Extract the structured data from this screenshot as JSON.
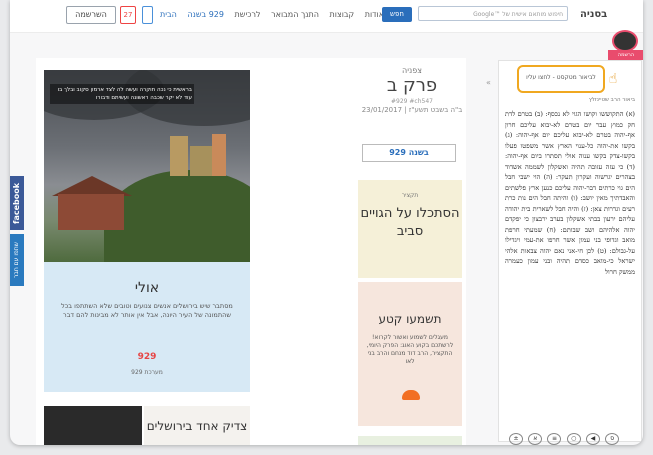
{
  "header": {
    "login_label": "השרשמה",
    "calendar_day": "27",
    "nav_items": [
      "אודות",
      "קבוצות",
      "התנך המבואר",
      "לרכישת"
    ],
    "counter_label": "929 בשנה",
    "home_label": "הבית",
    "search_button": "חפש",
    "search_placeholder": "Google™ חיפוש מותאם אישית של",
    "app_name": "בסניה"
  },
  "subheader": {
    "label": "ב"
  },
  "side": {
    "facebook": "facebook",
    "share": "שתפו עם חבר"
  },
  "feature": {
    "overlay_text": "בראשית כי נכה חוקרה ועשה לה לצד ארמון סקוב ובלך בו עוד לא יקר שכבה ראשונה ועשיתם ודבורו",
    "title": "אולי",
    "description": "מסתבר שיש בירושלים אנשים צנועים וטובים שלא השתתפו בכל שהתמונה של העיר היונה, אבל אין אותר לא מבינות להם דבר",
    "brand": "929",
    "brand_caption": "מערכת 929"
  },
  "bottom_card": {
    "title": "צדיק אחד בירושלים"
  },
  "chapter": {
    "book": "צפניה",
    "title": "פרק ב",
    "meta": "#929 #ch547",
    "date": "23/01/2017 | ב\"ה בשבט תשע\"ז",
    "counter_button": "929 בשנה"
  },
  "card_yellow": {
    "kicker": "תקציר",
    "title": "הסתכלו על הגויים סביב"
  },
  "card_pink": {
    "title": "תשמעו קטע",
    "description": "מעגלים לשמוע ואשור לקרוא! לרשתכם בקוע האוג: הפרק היומי, התקציר, הרב דוד מנחם והרב בני לאו"
  },
  "panel": {
    "header": "לביאור מטקסט - לחצו עליו",
    "subheading": "ביאור הרב שטיינזלץ",
    "text": "(א) התקוששו וקושו הגוי לא נכסף: (ב) בטרם לדת חק כמוץ עבר יום בטרם לא-יבוא עליכם חרון אף-יהוה בטרם לא-יבוא עליכם יום אף-יהוה: (ג) בקשו את-יהוה כל-ענוי הארץ אשר משפטו פעלו בקשו-צדק בקשו ענוה אולי תסתרו ביום אף-יהוה: (ד) כי עזה עזובה תהיה ואשקלון לשממה אשדוד בצהרים יגרשוה ועקרון תעקר: (ה) הוי ישבי חבל הים גוי כרתים דבר-יהוה עליכם כנען ארץ פלשתים והאבדתיך מאין יושב: (ו) והיתה חבל הים נות כרת רעים וגדרות צאן: (ז) והיה חבל לשארית בית יהודה עליהם ירעון בבתי אשקלון בערב ירבצון כי יפקדם יהוה אלהיהם ושב שבותם: (ח) שמעתי חרפת מואב וגדופי בני עמון אשר חרפו את-עמי ויגדילו על-גבולם: (ט) לכן חי-אני נאם יהוה צבאות אלהי ישראל כי-מואב כסדם תהיה ובני עמון כעמרה ממשק חרול",
    "tools": [
      "±",
      "א",
      "≡",
      "○",
      "◀",
      "ס"
    ]
  },
  "badge": {
    "tag": "הרשמה למהדורת"
  }
}
